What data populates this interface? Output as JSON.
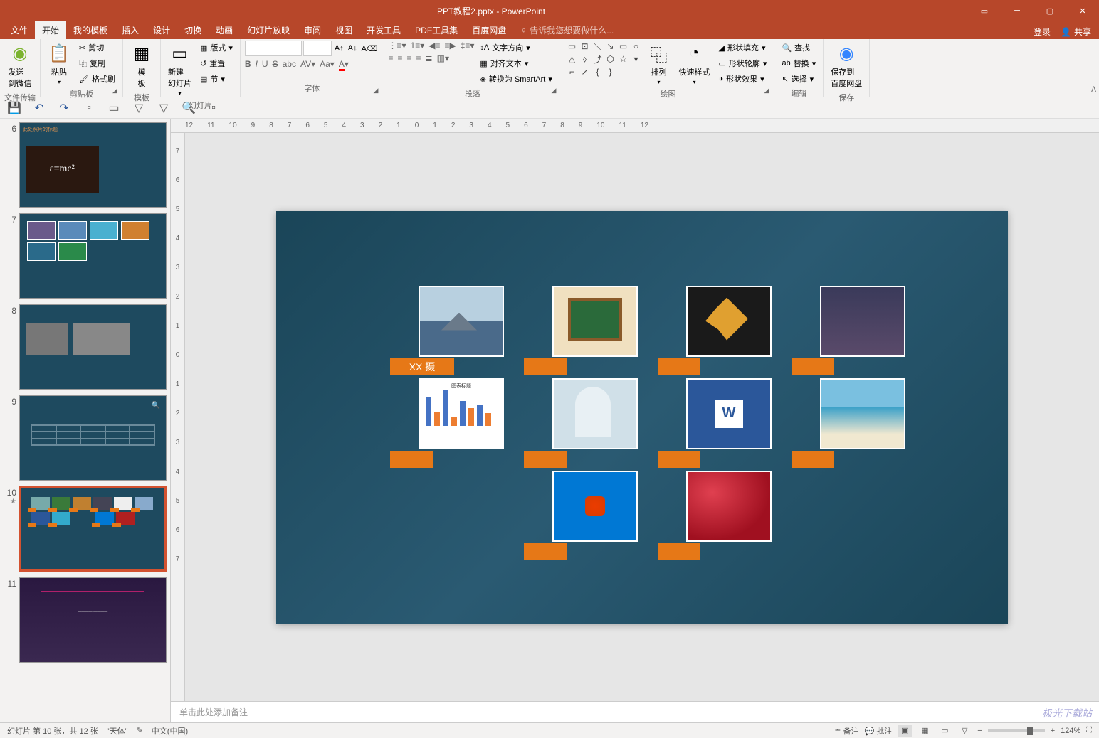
{
  "title": "PPT教程2.pptx - PowerPoint",
  "tabs": {
    "file": "文件",
    "home": "开始",
    "templates": "我的模板",
    "insert": "插入",
    "design": "设计",
    "transitions": "切换",
    "animations": "动画",
    "slideshow": "幻灯片放映",
    "review": "审阅",
    "view": "视图",
    "developer": "开发工具",
    "pdf": "PDF工具集",
    "baidu": "百度网盘"
  },
  "tell_me": "告诉我您想要做什么...",
  "login": "登录",
  "share": "共享",
  "ribbon": {
    "wechat": {
      "label": "发送\n到微信",
      "group": "文件传输"
    },
    "clipboard": {
      "paste": "粘贴",
      "cut": "剪切",
      "copy": "复制",
      "format_painter": "格式刷",
      "group": "剪贴板"
    },
    "templates": {
      "label": "模\n板",
      "group": "模板"
    },
    "slides": {
      "new": "新建\n幻灯片",
      "layout": "版式",
      "reset": "重置",
      "section": "节",
      "group": "幻灯片"
    },
    "font": {
      "group": "字体"
    },
    "paragraph": {
      "text_direction": "文字方向",
      "align_text": "对齐文本",
      "smartart": "转换为 SmartArt",
      "group": "段落"
    },
    "drawing": {
      "arrange": "排列",
      "quick_styles": "快速样式",
      "shape_fill": "形状填充",
      "shape_outline": "形状轮廓",
      "shape_effects": "形状效果",
      "group": "绘图"
    },
    "editing": {
      "find": "查找",
      "replace": "替换",
      "select": "选择",
      "group": "编辑"
    },
    "save": {
      "label": "保存到\n百度网盘",
      "group": "保存"
    }
  },
  "thumbs": {
    "n6": "6",
    "n7": "7",
    "n8": "8",
    "n9": "9",
    "n10": "10",
    "n11": "11",
    "t6_title": "此处照片的标题",
    "t6_eq": "ε=mc²"
  },
  "ruler_h": [
    "12",
    "11",
    "10",
    "9",
    "8",
    "7",
    "6",
    "5",
    "4",
    "3",
    "2",
    "1",
    "0",
    "1",
    "2",
    "3",
    "4",
    "5",
    "6",
    "7",
    "8",
    "9",
    "10",
    "11",
    "12"
  ],
  "ruler_v": [
    "7",
    "6",
    "5",
    "4",
    "3",
    "2",
    "1",
    "0",
    "1",
    "2",
    "3",
    "4",
    "5",
    "6",
    "7"
  ],
  "slide": {
    "label1": "XX 摄"
  },
  "notes_placeholder": "单击此处添加备注",
  "status": {
    "slide_info": "幻灯片 第 10 张，共 12 张",
    "theme": "\"天体\"",
    "lang": "中文(中国)",
    "notes": "备注",
    "comments": "批注",
    "zoom": "124%"
  },
  "watermark": "极光下载站"
}
